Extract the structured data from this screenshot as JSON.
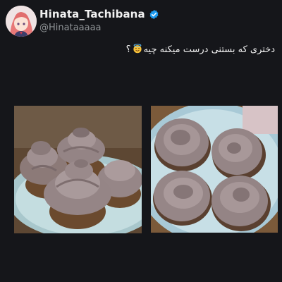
{
  "tweet": {
    "display_name": "Hinata_Tachibana",
    "handle": "@Hinataaaaa",
    "text": "دختری که بستنی درست میکنه چیه",
    "text_suffix": "؟",
    "verified": true,
    "colors": {
      "background": "#15161a",
      "verified_badge": "#1d9bf0",
      "handle": "#8f9396"
    }
  },
  "icons": {
    "verified": "verified-badge-icon",
    "emoji": "smiling-face-with-halo-emoji-icon"
  }
}
